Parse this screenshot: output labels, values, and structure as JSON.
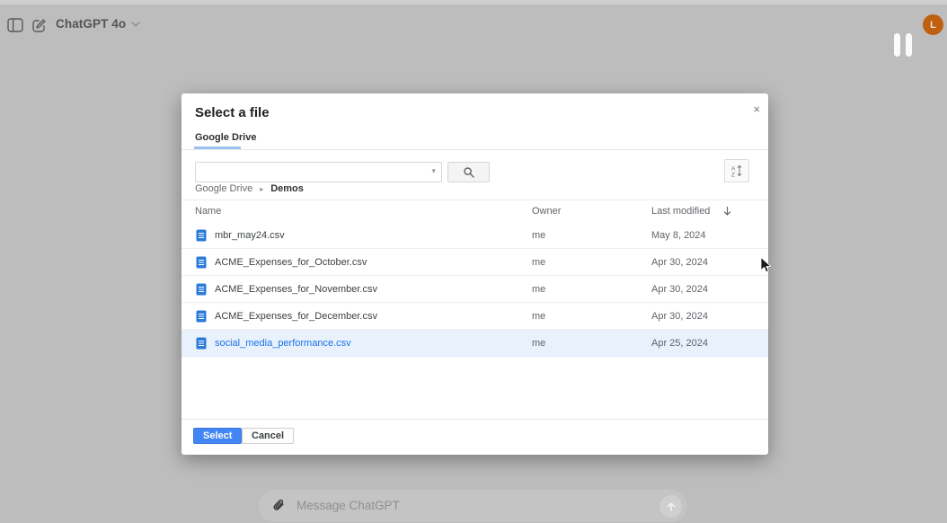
{
  "topbar": {
    "model_label": "ChatGPT 4o",
    "avatar_initial": "L"
  },
  "modal": {
    "title": "Select a file",
    "close_glyph": "×",
    "tab_label": "Google Drive",
    "combobox_caret": "▾",
    "breadcrumb": [
      "Google Drive",
      "Demos"
    ],
    "breadcrumb_sep": "▸",
    "table": {
      "columns": [
        "Name",
        "Owner",
        "Last modified"
      ],
      "rows": [
        {
          "name": "mbr_may24.csv",
          "owner": "me",
          "modified": "May 8, 2024",
          "selected": false
        },
        {
          "name": "ACME_Expenses_for_October.csv",
          "owner": "me",
          "modified": "Apr 30, 2024",
          "selected": false
        },
        {
          "name": "ACME_Expenses_for_November.csv",
          "owner": "me",
          "modified": "Apr 30, 2024",
          "selected": false
        },
        {
          "name": "ACME_Expenses_for_December.csv",
          "owner": "me",
          "modified": "Apr 30, 2024",
          "selected": false
        },
        {
          "name": "social_media_performance.csv",
          "owner": "me",
          "modified": "Apr 25, 2024",
          "selected": true
        }
      ]
    },
    "footer": {
      "select_label": "Select",
      "cancel_label": "Cancel"
    }
  },
  "composer": {
    "placeholder": "Message ChatGPT"
  },
  "colors": {
    "accent_blue": "#4285f4",
    "link_blue": "#1a73e8",
    "selected_row_bg": "#e9f1fc",
    "tab_underline": "#9dc0f2",
    "avatar_orange": "#bf5f10",
    "overlay_gray": "#bdbdbd",
    "file_icon_blue": "#2b7bd8"
  }
}
